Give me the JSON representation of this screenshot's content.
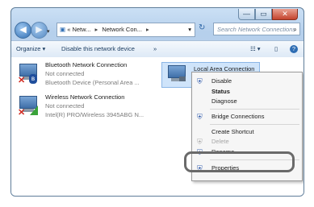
{
  "window": {
    "controls": {
      "minimize": "—",
      "maximize": "▭",
      "close": "✕"
    }
  },
  "nav": {
    "back_icon": "back-arrow-icon",
    "forward_icon": "forward-arrow-icon",
    "recent_icon": "chevron-down-icon",
    "address": {
      "root": "«",
      "crumb1": "Netw...",
      "crumb2": "Network Con...",
      "sep": "▸"
    },
    "refresh": "↻",
    "search_placeholder": "Search Network Connections",
    "search_icon": "⌕"
  },
  "toolbar": {
    "organize": "Organize ▾",
    "disable_device": "Disable this network device",
    "more": "»",
    "view_icon": "☷ ▾",
    "pane_icon": "▯",
    "help_icon": "?"
  },
  "connections": [
    {
      "name": "Bluetooth Network Connection",
      "status": "Not connected",
      "device": "Bluetooth Device (Personal Area ..."
    },
    {
      "name": "Wireless Network Connection",
      "status": "Not connected",
      "device": "Intel(R) PRO/Wireless 3945ABG N..."
    },
    {
      "name": "Local Area Connection",
      "status": "",
      "device": ""
    }
  ],
  "context_menu": {
    "items": [
      {
        "label": "Disable",
        "icon": "shield-icon"
      },
      {
        "label": "Status",
        "icon": ""
      },
      {
        "label": "Diagnose",
        "icon": ""
      },
      {
        "label": "Bridge Connections",
        "icon": "shield-icon"
      },
      {
        "label": "Create Shortcut",
        "icon": ""
      },
      {
        "label": "Delete",
        "icon": "shield-icon"
      },
      {
        "label": "Rename",
        "icon": "shield-icon"
      },
      {
        "label": "Properties",
        "icon": "shield-icon"
      }
    ]
  },
  "colors": {
    "accent": "#2e6db3",
    "highlight_ring": "#6a6a6a",
    "error_x": "#d0261c"
  }
}
